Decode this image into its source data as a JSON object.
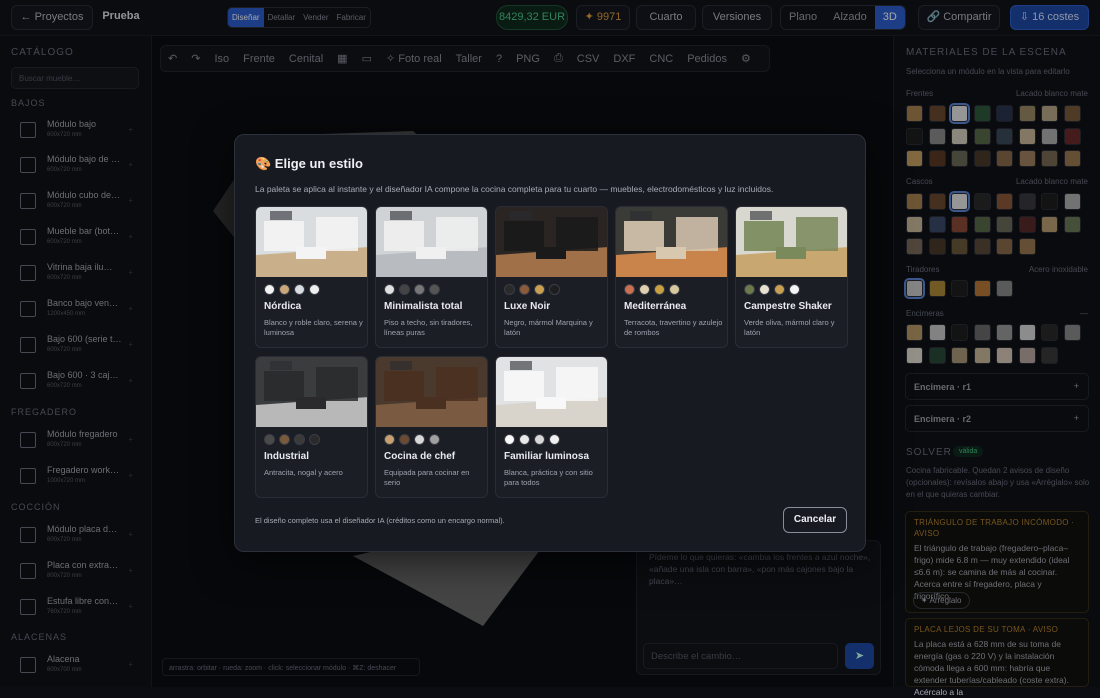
{
  "topbar": {
    "back": "← Proyectos",
    "project": "Prueba",
    "modes": [
      "Diseñar",
      "Detallar",
      "Vender",
      "Fabricar"
    ],
    "price": "8429,32 EUR",
    "credits": "✦ 9971",
    "room": "Cuarto",
    "versions": "Versiones",
    "views": [
      "Plano",
      "Alzado",
      "3D"
    ],
    "share": "🔗 Compartir",
    "costs": "⇩ 16 costes"
  },
  "catalog": {
    "title": "CATÁLOGO",
    "search_placeholder": "Buscar mueble…",
    "sections": [
      {
        "name": "BAJOS",
        "items": [
          {
            "name": "Módulo bajo",
            "size": "600x720 mm"
          },
          {
            "name": "Módulo bajo de …",
            "size": "600x720 mm"
          },
          {
            "name": "Módulo cubo de…",
            "size": "600x720 mm"
          },
          {
            "name": "Mueble bar (bot…",
            "size": "600x720 mm"
          },
          {
            "name": "Vitrina baja ilu…",
            "size": "600x720 mm"
          },
          {
            "name": "Banco bajo ven…",
            "size": "1200x450 mm"
          },
          {
            "name": "Bajo 600 (serie t…",
            "size": "600x720 mm"
          },
          {
            "name": "Bajo 600 · 3 caj…",
            "size": "600x720 mm"
          }
        ]
      },
      {
        "name": "FREGADERO",
        "items": [
          {
            "name": "Módulo fregadero",
            "size": "800x720 mm"
          },
          {
            "name": "Fregadero work…",
            "size": "1000x720 mm"
          }
        ]
      },
      {
        "name": "COCCIÓN",
        "items": [
          {
            "name": "Módulo placa d…",
            "size": "600x720 mm"
          },
          {
            "name": "Placa con extra…",
            "size": "800x720 mm"
          },
          {
            "name": "Estufa libre con…",
            "size": "760x720 mm"
          }
        ]
      },
      {
        "name": "ALACENAS",
        "items": [
          {
            "name": "Alacena",
            "size": "600x700 mm"
          }
        ]
      }
    ]
  },
  "toolbar": {
    "items": [
      "↶",
      "↷",
      "Iso",
      "Frente",
      "Cenital",
      "▦",
      "▭",
      "✧ Foto real",
      "Taller",
      "?",
      "PNG",
      "⎙",
      "CSV",
      "DXF",
      "CNC",
      "Pedidos",
      "⚙"
    ]
  },
  "materials": {
    "title": "MATERIALES DE LA ESCENA",
    "hint": "Selecciona un módulo en la vista para editarlo",
    "frentes": {
      "label": "Frentes",
      "value": "Lacado blanco mate",
      "swatches": [
        "#a8814f",
        "#6b4a32",
        "#e6e6e6",
        "#2d5a3c",
        "#2a3550",
        "#9a8a66",
        "#b8a888",
        "#7a5a3a",
        "#1e1e20",
        "#8c8c8c",
        "#d8cfbf",
        "#5a6b4a",
        "#3a4a5a",
        "#c8b898",
        "#b0b0b0",
        "#6a2a2a",
        "#c8a060",
        "#5a3a22",
        "#6a6a5a",
        "#4a3a2a",
        "#8a6a4a",
        "#a08060",
        "#7a6a55",
        "#9a7a50"
      ]
    },
    "cascos": {
      "label": "Cascos",
      "value": "Lacado blanco mate",
      "swatches": [
        "#a8814f",
        "#6b4a32",
        "#e6e6e6",
        "#2a2a2a",
        "#8a5a3a",
        "#3a3a40",
        "#1e1e20",
        "#b0b0b0",
        "#c8b898",
        "#3a4a6a",
        "#8a4a3a",
        "#5a6a4a",
        "#6a6a5a",
        "#5a2a2a",
        "#b8a070",
        "#6a7a5a",
        "#7a6a5a",
        "#4a3a2a",
        "#6a5a3a",
        "#5a4a3a",
        "#8a6a4a",
        "#9a7a50"
      ]
    },
    "tiradores": {
      "label": "Tiradores",
      "value": "Acero inoxidable",
      "swatches": [
        "#c9c9c9",
        "#b08a3a",
        "#1e1e20",
        "#b87a3a",
        "#8a8a8a"
      ]
    },
    "encimeras": {
      "label": "Encimeras",
      "value": "—",
      "swatches": [
        "#b89868",
        "#c8c8c8",
        "#1e1e20",
        "#6a6a6a",
        "#9a9a9a",
        "#d8d8d8",
        "#2a2a2a",
        "#8a8a8a",
        "#e0dcd0",
        "#2a4a3a",
        "#a89878",
        "#c8b898",
        "#d8c8b8",
        "#b8a8a0",
        "#3a3a3a"
      ]
    },
    "encimera1": "Encimera · r1",
    "encimera2": "Encimera · r2"
  },
  "solver": {
    "title": "SOLVER",
    "badge": "válida",
    "text": "Cocina fabricable. Quedan 2 avisos de diseño (opcionales): revísalos abajo y usa «Arréglalo» solo en el que quieras cambiar.",
    "warn1_title": "TRIÁNGULO DE TRABAJO INCÓMODO · AVISO",
    "warn1_body": "El triángulo de trabajo (fregadero–placa–frigo) mide 6.8 m — muy extendido (ideal ≤6.6 m): se camina de más al cocinar. Acerca entre sí fregadero, placa y frigorífico.",
    "fix": "✦ Arréglalo",
    "warn2_title": "PLACA LEJOS DE SU TOMA · AVISO",
    "warn2_body": "La placa está a 628 mm de su toma de energía (gas o 220 V) y la instalación cómoda llega a 600 mm: habría que extender tuberías/cableado (coste extra). Acércalo a la"
  },
  "chat": {
    "hint": "Pídeme lo que quieras: «cambia los frentes a azul noche», «añade una isla con barra», «pon más cajones bajo la placa»…",
    "placeholder": "Describe el cambio…"
  },
  "hint_bar": "arrastra: orbitar · rueda: zoom · click: seleccionar módulo · ⌘Z: deshacer",
  "modal": {
    "title": "🎨 Elige un estilo",
    "subtitle": "La paleta se aplica al instante y el diseñador IA compone la cocina completa para tu cuarto — muebles, electrodomésticos y luz incluidos.",
    "footer": "El diseño completo usa el diseñador IA (créditos como un encargo normal).",
    "cancel": "Cancelar",
    "styles": [
      {
        "name": "Nórdica",
        "desc": "Blanco y roble claro, serena y luminosa",
        "dots": [
          "#f2f2f2",
          "#c8a878",
          "#d8dde2",
          "#eeeeee"
        ],
        "bg": "#d9dde0",
        "cab": "#f4f4f4",
        "floor": "#c9b08a"
      },
      {
        "name": "Minimalista total",
        "desc": "Piso a techo, sin tiradores, líneas puras",
        "dots": [
          "#e0e0e0",
          "#444444",
          "#777777",
          "#555555"
        ],
        "bg": "#d0d3d6",
        "cab": "#f0f0f0",
        "floor": "#b8bcc0"
      },
      {
        "name": "Luxe Noir",
        "desc": "Negro, mármol Marquina y latón",
        "dots": [
          "#2a2a2a",
          "#8a5a3a",
          "#c8a050",
          "#1e1e1e"
        ],
        "bg": "#2a2522",
        "cab": "#1a1a1a",
        "floor": "#a07048"
      },
      {
        "name": "Mediterránea",
        "desc": "Terracota, travertino y azulejo de rombos",
        "dots": [
          "#c87050",
          "#e0d0b0",
          "#c8a040",
          "#d8c8a0"
        ],
        "bg": "#3a3a36",
        "cab": "#d8c8b0",
        "floor": "#c8844a"
      },
      {
        "name": "Campestre Shaker",
        "desc": "Verde oliva, mármol claro y latón",
        "dots": [
          "#6a7a4a",
          "#e8e0d0",
          "#c8a050",
          "#f4f4f4"
        ],
        "bg": "#d8d8d0",
        "cab": "#7a8a5a",
        "floor": "#c8a870"
      },
      {
        "name": "Industrial",
        "desc": "Antracita, nogal y acero",
        "dots": [
          "#4a4a4a",
          "#7a5a3a",
          "#3a3a3a",
          "#2a2a2a"
        ],
        "bg": "#3a3c3e",
        "cab": "#2a2a2c",
        "floor": "#b8b8b8"
      },
      {
        "name": "Cocina de chef",
        "desc": "Equipada para cocinar en serio",
        "dots": [
          "#c8a070",
          "#6a4a30",
          "#d8d8d8",
          "#a0a0a0"
        ],
        "bg": "#4a3a2e",
        "cab": "#4a3020",
        "floor": "#7a5a40"
      },
      {
        "name": "Familiar luminosa",
        "desc": "Blanca, práctica y con sitio para todos",
        "dots": [
          "#f8f8f8",
          "#e8e8e8",
          "#d8d8d8",
          "#f0f0f0"
        ],
        "bg": "#e0e2e4",
        "cab": "#f8f8f8",
        "floor": "#d8d4cc"
      }
    ]
  }
}
